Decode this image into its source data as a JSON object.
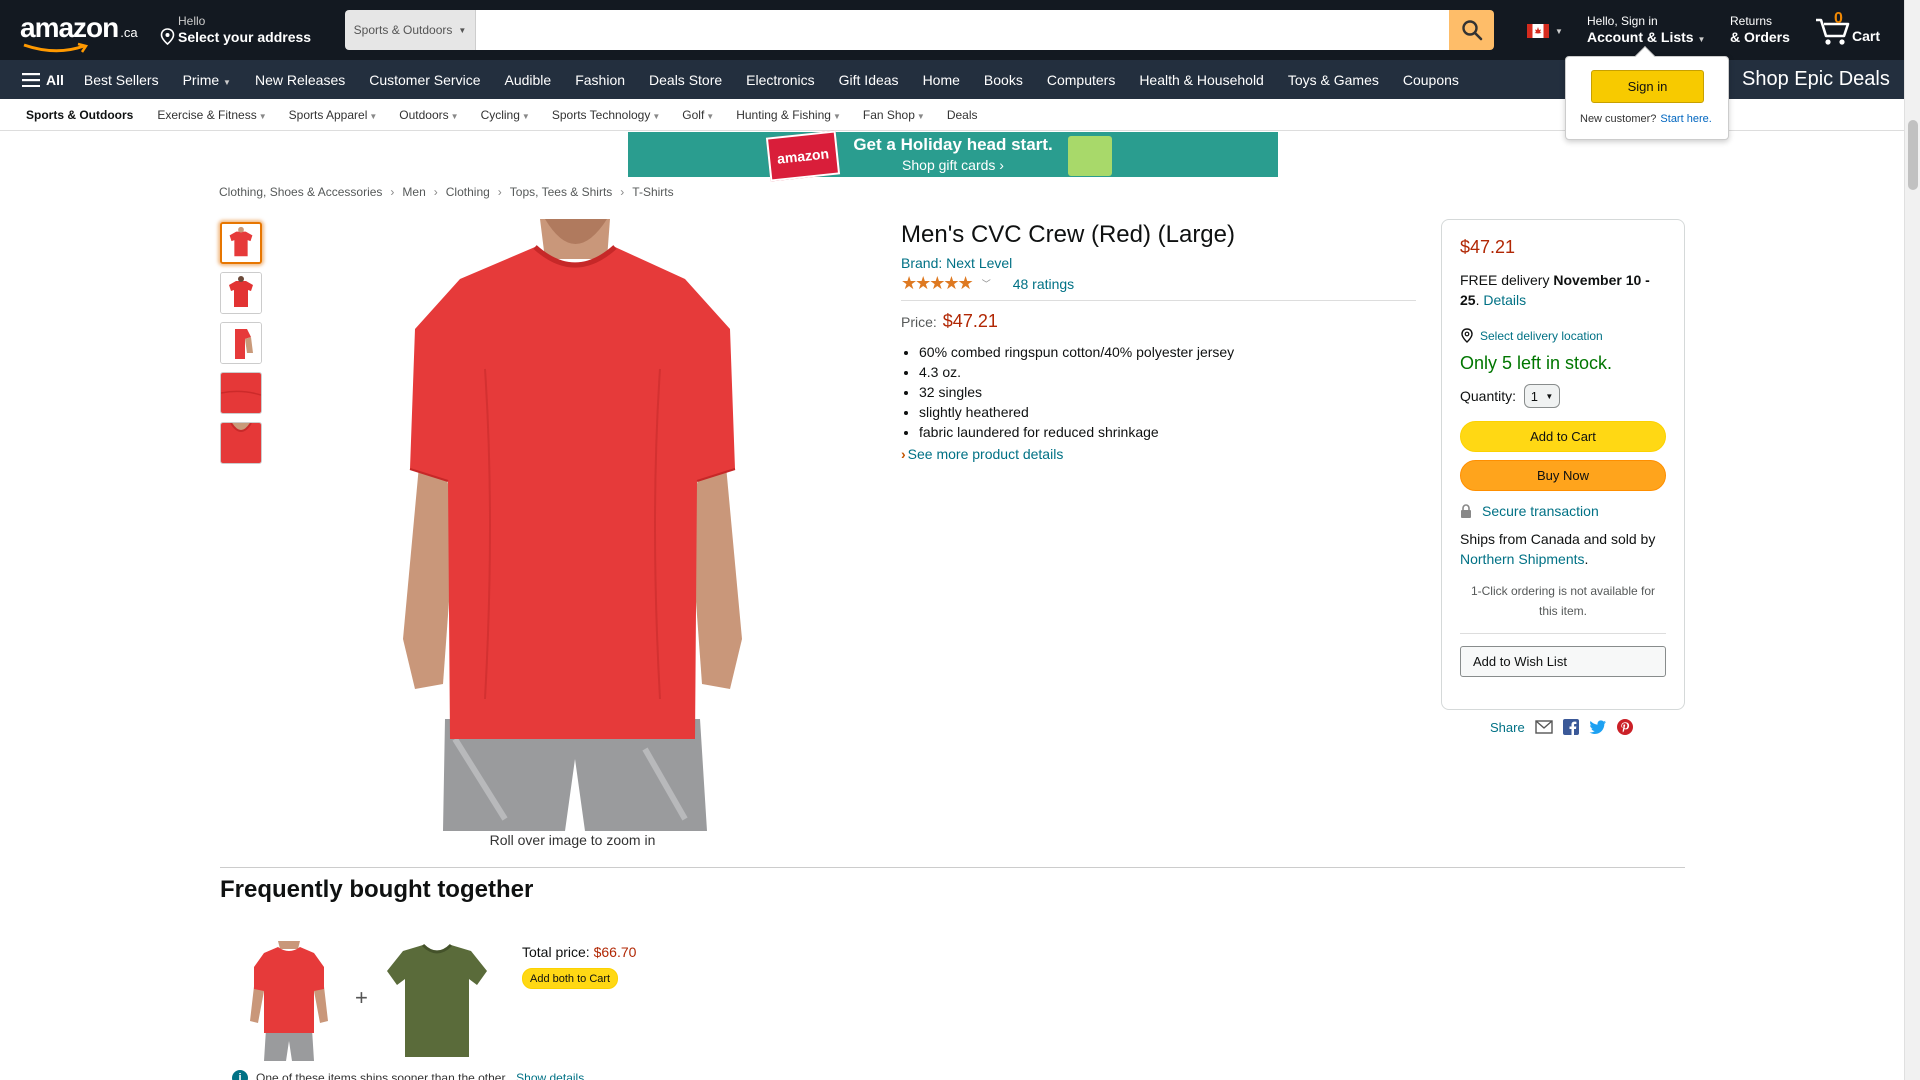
{
  "header": {
    "logo_text": "amazon",
    "logo_suffix": ".ca",
    "address_line1": "Hello",
    "address_line2": "Select your address",
    "search_category": "Sports & Outdoors",
    "search_placeholder": "",
    "account_line1": "Hello, Sign in",
    "account_line2": "Account & Lists",
    "returns_line1": "Returns",
    "returns_line2": "& Orders",
    "cart_count": "0",
    "cart_label": "Cart"
  },
  "nav": {
    "all_label": "All",
    "items": [
      "Best Sellers",
      "Prime",
      "New Releases",
      "Customer Service",
      "Audible",
      "Fashion",
      "Deals Store",
      "Electronics",
      "Gift Ideas",
      "Home",
      "Books",
      "Computers",
      "Health & Household",
      "Toys & Games",
      "Coupons"
    ],
    "promo": "Shop Epic Deals"
  },
  "subnav": {
    "title": "Sports & Outdoors",
    "items": [
      "Exercise & Fitness",
      "Sports Apparel",
      "Outdoors",
      "Cycling",
      "Sports Technology",
      "Golf",
      "Hunting & Fishing",
      "Fan Shop",
      "Deals"
    ]
  },
  "flyout": {
    "signin_label": "Sign in",
    "new_customer": "New customer?",
    "start_here": "Start here."
  },
  "banner": {
    "line1": "Get a Holiday head start.",
    "line2": "Shop gift cards ›",
    "card_text": "amazon"
  },
  "breadcrumb": [
    "Clothing, Shoes & Accessories",
    "Men",
    "Clothing",
    "Tops, Tees & Shirts",
    "T-Shirts"
  ],
  "product": {
    "title": "Men's CVC Crew (Red) (Large)",
    "brand": "Brand: Next Level",
    "stars": "★★★★★",
    "rating_value": 5,
    "ratings_count": "48 ratings",
    "price_label": "Price:",
    "price": "$47.21",
    "bullets": [
      "60% combed ringspun cotton/40% polyester jersey",
      "4.3 oz.",
      "32 singles",
      "slightly heathered",
      "fabric laundered for reduced shrinkage"
    ],
    "see_more": "See more product details",
    "zoom_hint": "Roll over image to zoom in"
  },
  "buybox": {
    "price": "$47.21",
    "delivery_prefix": "FREE delivery ",
    "delivery_dates": "November 10 - 25",
    "delivery_suffix": ". ",
    "details_link": "Details",
    "location": "Select delivery location",
    "stock": "Only 5 left in stock.",
    "qty_label": "Quantity:",
    "qty_value": "1",
    "add_to_cart": "Add to Cart",
    "buy_now": "Buy Now",
    "secure": "Secure transaction",
    "ships_from": "Ships from Canada and sold by ",
    "seller": "Northern Shipments",
    "ships_suffix": ".",
    "oneclick": "1-Click ordering is not available for this item.",
    "wishlist": "Add to Wish List"
  },
  "share": {
    "label": "Share"
  },
  "fbt": {
    "title": "Frequently bought together",
    "total_label": "Total price: ",
    "total_price": "$66.70",
    "add_both": "Add both to Cart",
    "note": "One of these items ships sooner than the other.",
    "show_details": "Show details"
  },
  "colors": {
    "header_bg": "#131921",
    "nav_bg": "#232f3e",
    "price": "#b12704",
    "link": "#007185",
    "stock": "#007600",
    "cart_btn": "#ffd814",
    "buy_btn": "#ffa41c",
    "shirt_red": "#e63a3a",
    "shirt_olive": "#5a6b3a"
  }
}
